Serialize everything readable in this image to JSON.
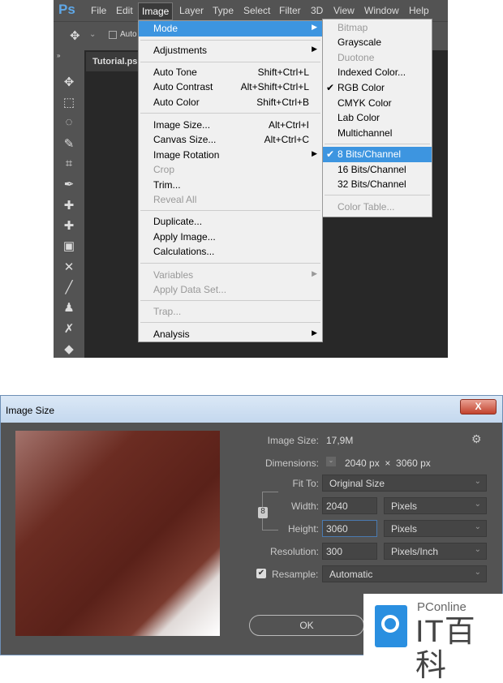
{
  "app": {
    "logo": "Ps",
    "menus": [
      "File",
      "Edit",
      "Image",
      "Layer",
      "Type",
      "Select",
      "Filter",
      "3D",
      "View",
      "Window",
      "Help"
    ],
    "options_auto": "Auto",
    "doc_tab": "Tutorial.ps"
  },
  "image_menu": [
    {
      "label": "Mode",
      "submenu": true,
      "highlighted": true
    },
    {
      "label": "Adjustments",
      "submenu": true
    },
    {
      "label": "Auto Tone",
      "shortcut": "Shift+Ctrl+L"
    },
    {
      "label": "Auto Contrast",
      "shortcut": "Alt+Shift+Ctrl+L"
    },
    {
      "label": "Auto Color",
      "shortcut": "Shift+Ctrl+B"
    },
    {
      "label": "Image Size...",
      "shortcut": "Alt+Ctrl+I"
    },
    {
      "label": "Canvas Size...",
      "shortcut": "Alt+Ctrl+C"
    },
    {
      "label": "Image Rotation",
      "submenu": true
    },
    {
      "label": "Crop",
      "disabled": true
    },
    {
      "label": "Trim..."
    },
    {
      "label": "Reveal All",
      "disabled": true
    },
    {
      "label": "Duplicate..."
    },
    {
      "label": "Apply Image..."
    },
    {
      "label": "Calculations..."
    },
    {
      "label": "Variables",
      "submenu": true,
      "disabled": true
    },
    {
      "label": "Apply Data Set...",
      "disabled": true
    },
    {
      "label": "Trap...",
      "disabled": true
    },
    {
      "label": "Analysis",
      "submenu": true
    }
  ],
  "mode_menu": [
    {
      "label": "Bitmap",
      "disabled": true
    },
    {
      "label": "Grayscale"
    },
    {
      "label": "Duotone",
      "disabled": true
    },
    {
      "label": "Indexed Color..."
    },
    {
      "label": "RGB Color",
      "checked": true
    },
    {
      "label": "CMYK Color"
    },
    {
      "label": "Lab Color"
    },
    {
      "label": "Multichannel"
    },
    {
      "label": "8 Bits/Channel",
      "checked": true,
      "highlighted": true
    },
    {
      "label": "16 Bits/Channel"
    },
    {
      "label": "32 Bits/Channel"
    },
    {
      "label": "Color Table...",
      "disabled": true
    }
  ],
  "dialog": {
    "title": "Image Size",
    "close": "X",
    "image_size_label": "Image Size:",
    "image_size": "17,9M",
    "dimensions_label": "Dimensions:",
    "dimensions": "2040 px  ×  3060 px",
    "fit_to_label": "Fit To:",
    "fit_to": "Original Size",
    "width_label": "Width:",
    "width": "2040",
    "width_unit": "Pixels",
    "height_label": "Height:",
    "height": "3060",
    "height_unit": "Pixels",
    "resolution_label": "Resolution:",
    "resolution": "300",
    "resolution_unit": "Pixels/Inch",
    "resample_label": "Resample:",
    "resample_checked": true,
    "resample": "Automatic",
    "ok": "OK"
  },
  "watermark": {
    "brand": "PConline",
    "name": "IT百科",
    "color": "#2a8fe0"
  }
}
